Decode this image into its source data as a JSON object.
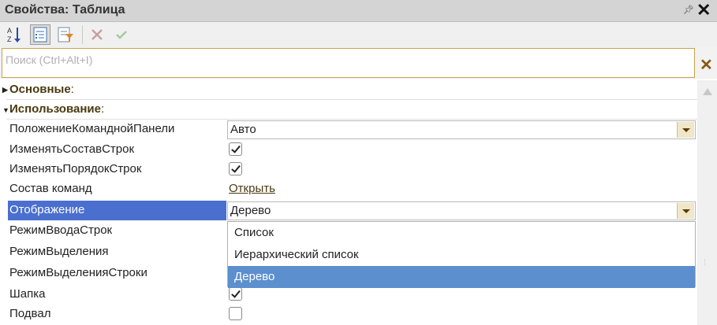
{
  "window": {
    "title": "Свойства: Таблица",
    "pin_icon": "pin-icon",
    "close_icon": "close-icon"
  },
  "toolbar": {
    "buttons": [
      "sort-az-icon",
      "categories-icon",
      "filter-icon",
      "cancel-icon",
      "apply-icon"
    ]
  },
  "search": {
    "placeholder": "Поиск (Ctrl+Alt+I)",
    "value": ""
  },
  "groups": [
    {
      "label": "Основные",
      "suffix": ":"
    },
    {
      "label": "Использование",
      "suffix": ":"
    }
  ],
  "properties": [
    {
      "label": "ПоложениеКоманднойПанели",
      "value": "Авто"
    },
    {
      "label": "ИзменятьСоставСтрок",
      "checked": true
    },
    {
      "label": "ИзменятьПорядокСтрок",
      "checked": true
    },
    {
      "label": "Состав команд",
      "link": "Открыть"
    },
    {
      "label": "Отображение",
      "value": "Дерево"
    },
    {
      "label": "РежимВводаСтрок"
    },
    {
      "label": "РежимВыделения"
    },
    {
      "label": "РежимВыделенияСтроки"
    },
    {
      "label": "Шапка",
      "checked": true
    },
    {
      "label": "Подвал",
      "checked": false
    }
  ],
  "dropdown": {
    "options": [
      "Список",
      "Иерархический список",
      "Дерево"
    ],
    "selected": "Дерево"
  },
  "colors": {
    "accent_selected": "#4a6fcf",
    "dropdown_selected": "#5c8fce",
    "search_border": "#c7a24a"
  }
}
